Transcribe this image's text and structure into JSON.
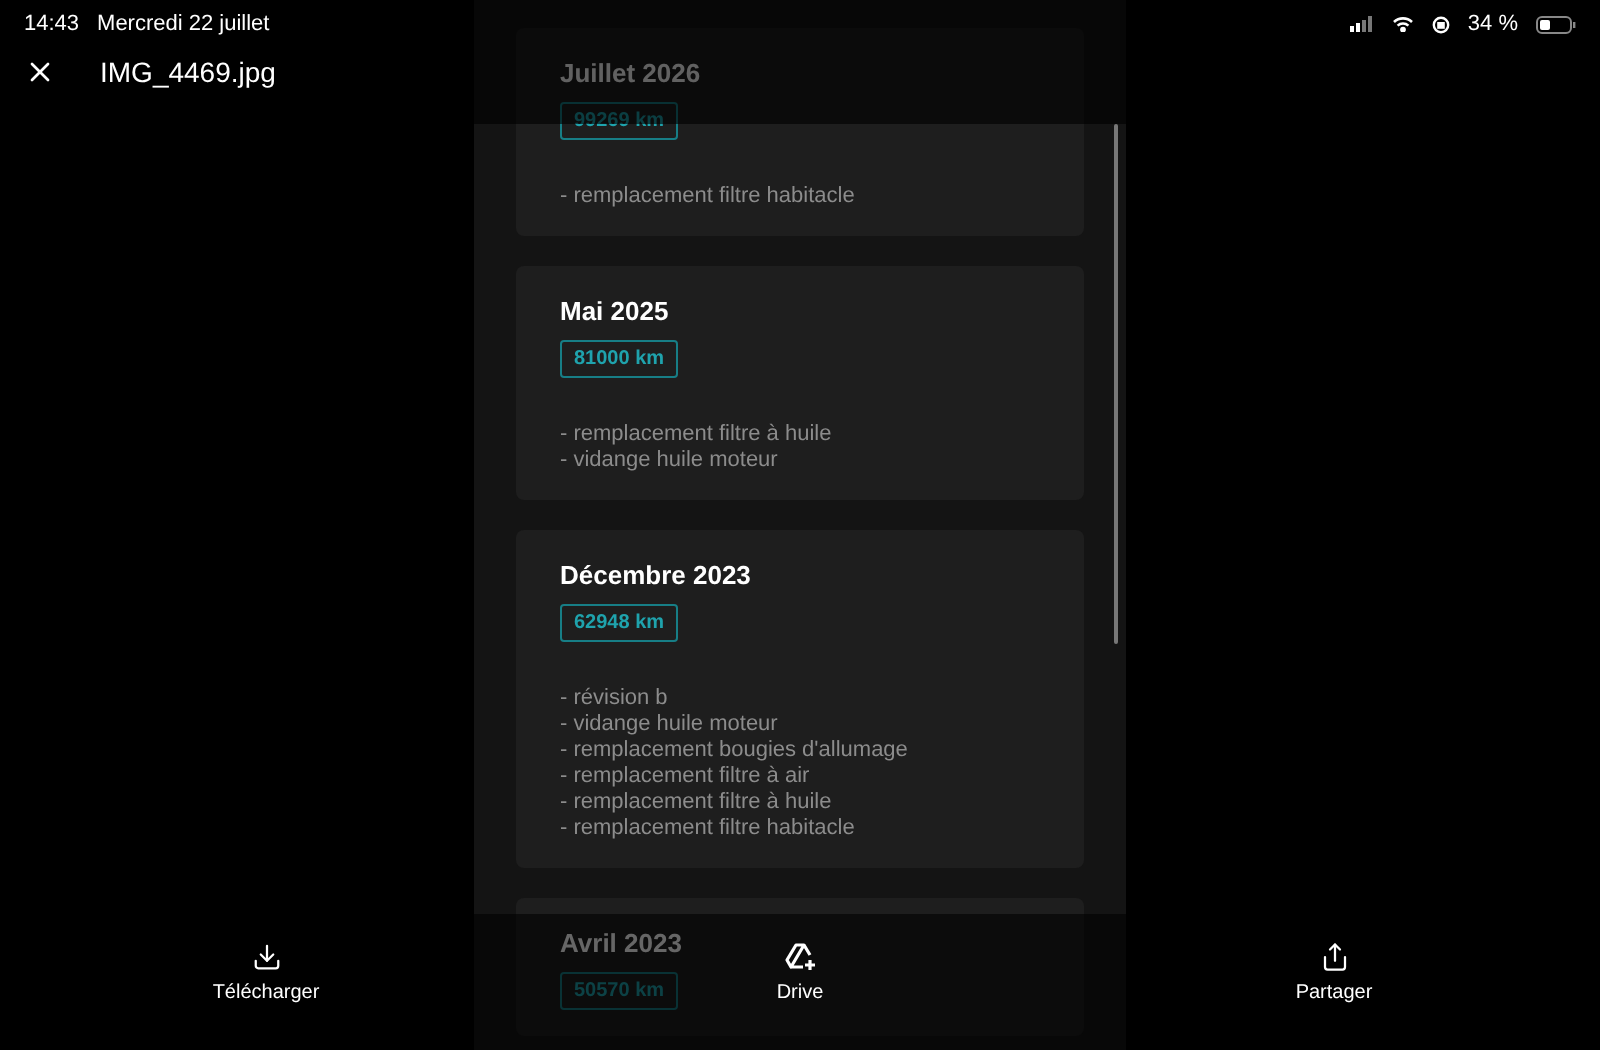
{
  "status_bar": {
    "time": "14:43",
    "date": "Mercredi 22 juillet",
    "battery": "34 %"
  },
  "header": {
    "title": "IMG_4469.jpg"
  },
  "entries": [
    {
      "title": "Juillet 2026",
      "km": "99269 km",
      "items": [
        "- remplacement filtre habitacle"
      ]
    },
    {
      "title": "Mai 2025",
      "km": "81000 km",
      "items": [
        "- remplacement filtre à huile",
        "- vidange huile moteur"
      ]
    },
    {
      "title": "Décembre 2023",
      "km": "62948 km",
      "items": [
        "- révision b",
        "- vidange huile moteur",
        "- remplacement bougies d'allumage",
        "- remplacement filtre à air",
        "- remplacement filtre à huile",
        "- remplacement filtre habitacle"
      ]
    },
    {
      "title": "Avril 2023",
      "km": "50570 km"
    }
  ],
  "toolbar": [
    {
      "kind": "download",
      "label": "Télécharger"
    },
    {
      "kind": "drive",
      "label": "Drive"
    },
    {
      "kind": "share",
      "label": "Partager"
    }
  ]
}
